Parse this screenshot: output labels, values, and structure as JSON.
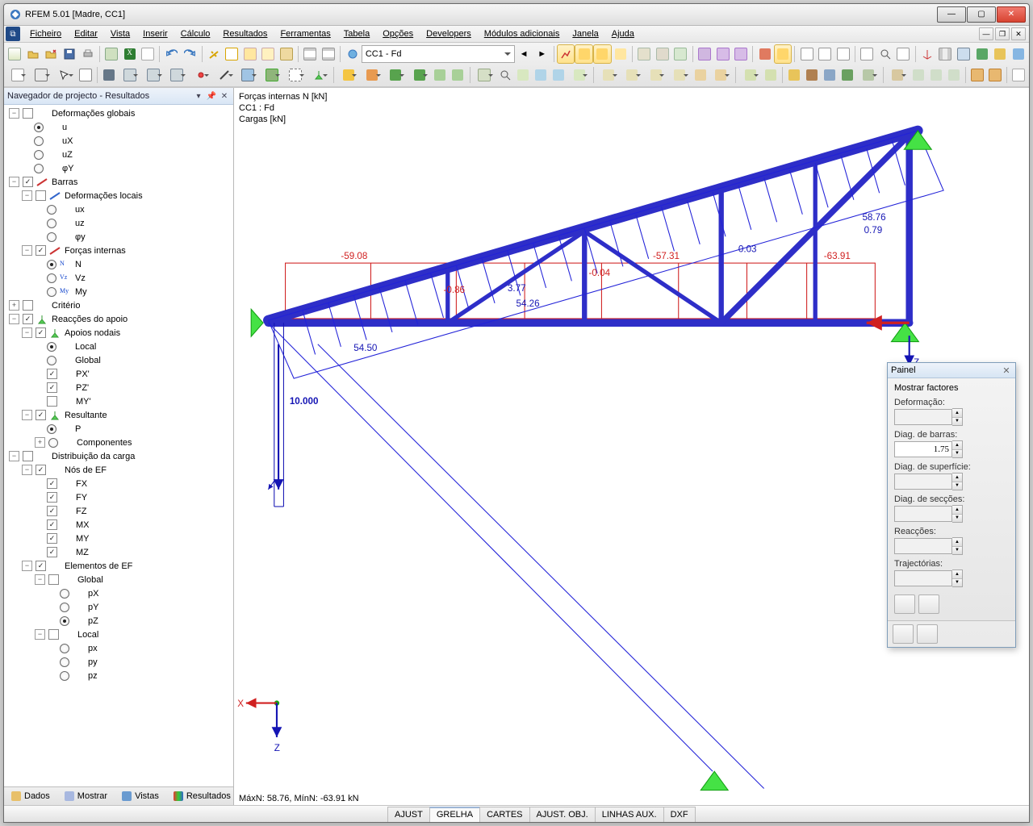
{
  "title": "RFEM 5.01 [Madre, CC1]",
  "menu": [
    "Ficheiro",
    "Editar",
    "Vista",
    "Inserir",
    "Cálculo",
    "Resultados",
    "Ferramentas",
    "Tabela",
    "Opções",
    "Developers",
    "Módulos adicionais",
    "Janela",
    "Ajuda"
  ],
  "combo_case": "CC1 - Fd",
  "navigator": {
    "title": "Navegador de projecto - Resultados",
    "items": {
      "def_glob": "Deformações globais",
      "u": "u",
      "ux": "uX",
      "uz": "uZ",
      "phiy": "φY",
      "barras": "Barras",
      "def_loc": "Deformações locais",
      "lux": "ux",
      "luz": "uz",
      "lphi": "φy",
      "fint": "Forças internas",
      "N": "N",
      "Vz": "Vz",
      "My": "My",
      "crit": "Critério",
      "reac": "Reacções do apoio",
      "nodal": "Apoios nodais",
      "local": "Local",
      "global": "Global",
      "px": "PX'",
      "pz": "PZ'",
      "my": "MY'",
      "result": "Resultante",
      "rp": "P",
      "comp": "Componentes",
      "dist": "Distribuição da carga",
      "efn": "Nós de EF",
      "FX": "FX",
      "FY": "FY",
      "FZ": "FZ",
      "MX": "MX",
      "MY": "MY",
      "MZ": "MZ",
      "efe": "Elementos de EF",
      "eglob": "Global",
      "eloc": "Local",
      "pX": "pX",
      "pY": "pY",
      "pZ": "pZ",
      "plx": "px",
      "ply": "py",
      "plz": "pz"
    },
    "tabs": [
      "Dados",
      "Mostrar",
      "Vistas",
      "Resultados"
    ]
  },
  "viewport": {
    "header": [
      "Forças internas N [kN]",
      "CC1 : Fd",
      "Cargas [kN]"
    ],
    "labels": {
      "top_red": [
        "-59.08",
        "-57.31",
        "-63.91"
      ],
      "mid_blue": [
        "-0.86",
        "3.77",
        "-0.04",
        "0.03",
        "58.76",
        "0.79",
        "54.26",
        "54.50"
      ],
      "load": "10.000",
      "axis_z": "Z",
      "axis_x": "X",
      "axis_z2": "Z"
    },
    "maxmin": "MáxN: 58.76, MínN: -63.91 kN"
  },
  "panel": {
    "title": "Painel",
    "show_factors": "Mostrar factores",
    "groups": {
      "def": "Deformação:",
      "bar": "Diag. de barras:",
      "surf": "Diag. de superfície:",
      "sec": "Diag. de secções:",
      "reac": "Reacções:",
      "traj": "Trajectórias:"
    },
    "bar_value": "1.75"
  },
  "status_tabs": [
    "AJUST",
    "GRELHA",
    "CARTES",
    "AJUST. OBJ.",
    "LINHAS AUX.",
    "DXF"
  ]
}
